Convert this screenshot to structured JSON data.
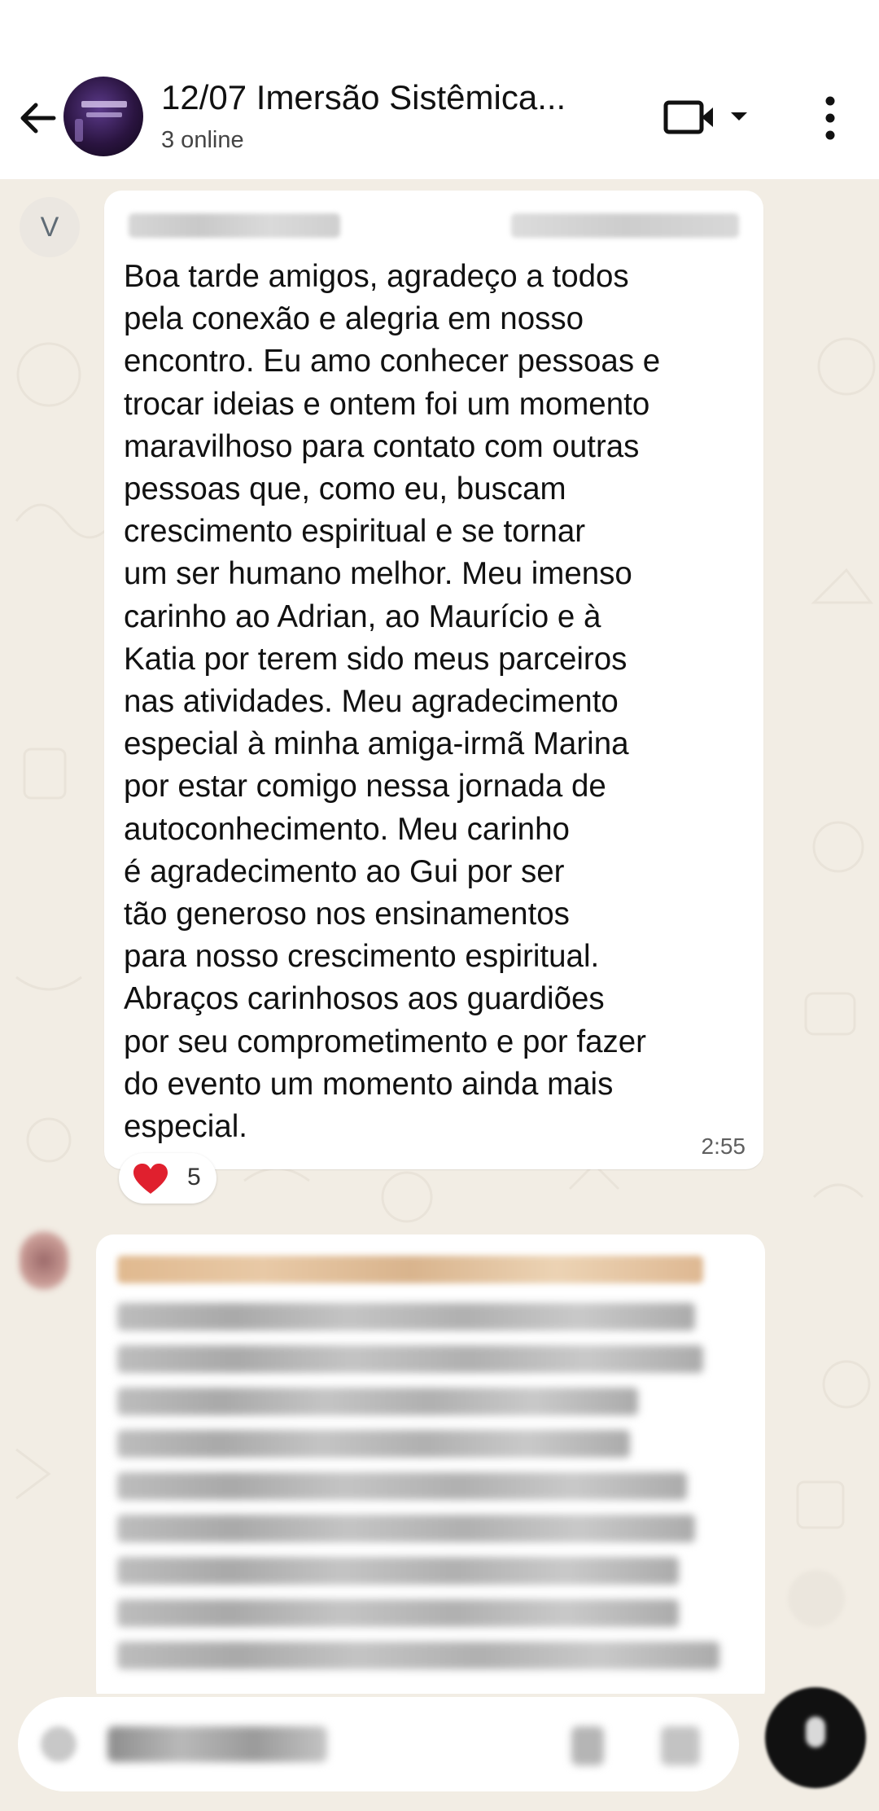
{
  "header": {
    "title": "12/07 Imersão Sistêmica...",
    "subtitle": "3 online"
  },
  "messages": [
    {
      "sender_initial": "V",
      "text": "Boa tarde amigos, agradeço a todos\npela conexão e alegria em nosso\nencontro.  Eu amo conhecer pessoas e\ntrocar ideias e ontem foi um momento\nmaravilhoso para contato com outras\npessoas que,  como eu, buscam\ncrescimento espiritual e se tornar\num ser humano melhor.  Meu imenso\ncarinho ao Adrian, ao Maurício e à\nKatia por terem sido meus parceiros\nnas atividades. Meu agradecimento\nespecial à minha amiga-irmã Marina\npor estar comigo nessa jornada de\nautoconhecimento. Meu carinho\né agradecimento ao Gui por ser\ntão generoso nos ensinamentos\npara nosso crescimento espiritual.\nAbraços carinhosos aos guardiões\npor seu comprometimento e por fazer\ndo evento um momento ainda mais\nespecial.",
      "time": "2:55",
      "reaction": {
        "icon": "heart-icon",
        "count": "5"
      }
    }
  ],
  "colors": {
    "chat_background": "#f2ede4",
    "bubble": "#ffffff",
    "header": "#ffffff",
    "reaction_heart": "#e0202e",
    "mic_button": "#111111"
  }
}
